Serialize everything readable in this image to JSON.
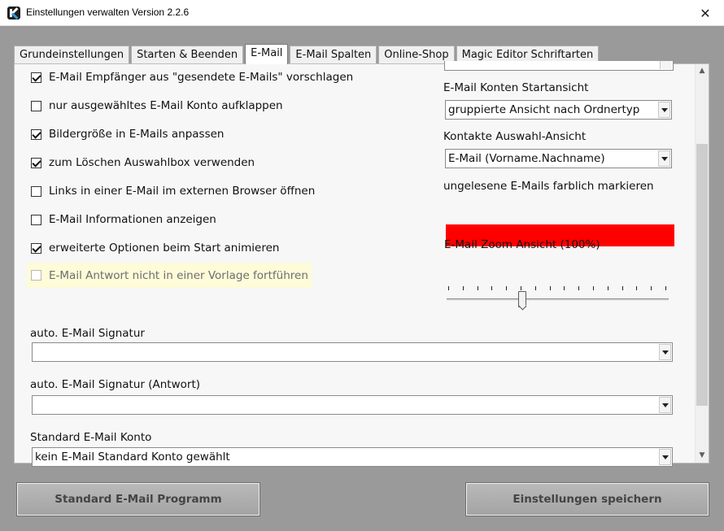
{
  "window": {
    "title": "Einstellungen verwalten Version 2.2.6",
    "close_symbol": "✕",
    "app_icon": "k-logo-icon"
  },
  "tabs": [
    {
      "label": "Grundeinstellungen",
      "active": false
    },
    {
      "label": "Starten & Beenden",
      "active": false
    },
    {
      "label": "E-Mail",
      "active": true
    },
    {
      "label": "E-Mail Spalten",
      "active": false
    },
    {
      "label": "Online-Shop",
      "active": false
    },
    {
      "label": "Magic Editor Schriftarten",
      "active": false
    }
  ],
  "checkboxes": [
    {
      "label": "E-Mail Empfänger aus \"gesendete E-Mails\" vorschlagen",
      "checked": true
    },
    {
      "label": "nur ausgewähltes E-Mail Konto aufklappen",
      "checked": false
    },
    {
      "label": "Bildergröße in E-Mails anpassen",
      "checked": true
    },
    {
      "label": "zum Löschen Auswahlbox verwenden",
      "checked": true
    },
    {
      "label": "Links in einer E-Mail im externen Browser öffnen",
      "checked": false
    },
    {
      "label": "E-Mail Informationen anzeigen",
      "checked": false
    },
    {
      "label": "erweiterte Optionen beim Start animieren",
      "checked": true
    },
    {
      "label": "E-Mail Antwort nicht in einer Vorlage fortführen",
      "checked": false,
      "disabled": true
    }
  ],
  "right": {
    "konten_label": "E-Mail Konten Startansicht",
    "konten_value": "gruppierte Ansicht nach Ordnertyp",
    "kontakte_label": "Kontakte Auswahl-Ansicht",
    "kontakte_value": "E-Mail (Vorname.Nachname)",
    "ungelesen_label": "ungelesene E-Mails farblich markieren",
    "ungelesen_color": "#ff0000",
    "zoom_label": "E-Mail Zoom Ansicht (100%)",
    "zoom_level_percent": 100
  },
  "signatur": {
    "label": "auto. E-Mail Signatur",
    "value": ""
  },
  "signatur_antwort": {
    "label": "auto. E-Mail Signatur (Antwort)",
    "value": ""
  },
  "konto": {
    "label": "Standard E-Mail Konto",
    "value": "kein E-Mail Standard Konto gewählt"
  },
  "buttons": {
    "standard_programm": "Standard E-Mail Programm",
    "speichern": "Einstellungen speichern"
  },
  "colors": {
    "accent_red": "#ff0000",
    "highlight_row": "#fdfbd8"
  }
}
